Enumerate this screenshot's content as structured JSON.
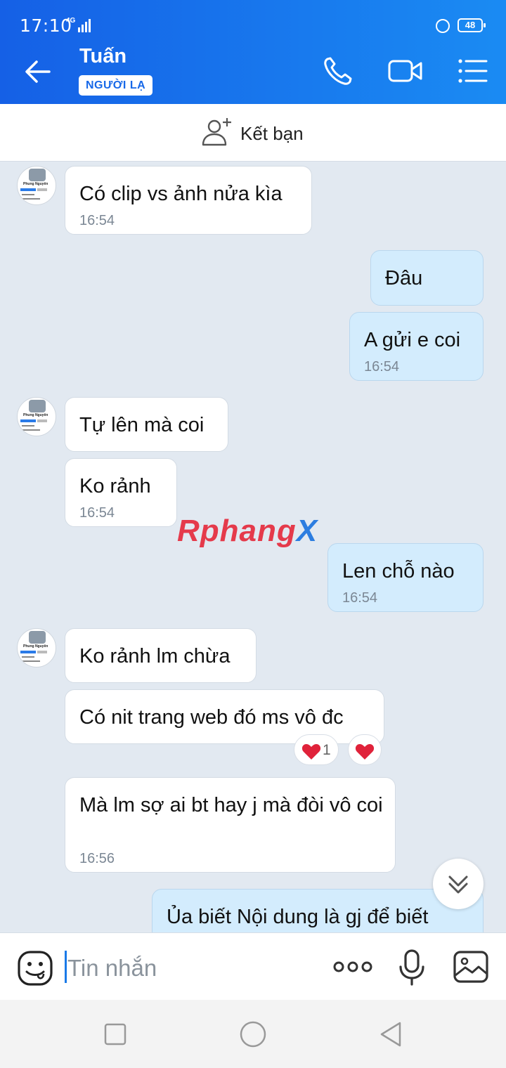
{
  "status": {
    "time": "17:10",
    "network": "4G",
    "battery": "48"
  },
  "header": {
    "name": "Tuấn",
    "badge": "NGƯỜI LẠ"
  },
  "add_friend": {
    "label": "Kết bạn"
  },
  "messages": [
    {
      "text": "Có clip vs ảnh nửa kìa",
      "time": "16:54"
    },
    {
      "text": "Đâu"
    },
    {
      "text": "A gửi e coi",
      "time": "16:54"
    },
    {
      "text": "Tự lên mà coi"
    },
    {
      "text": "Ko rảnh",
      "time": "16:54"
    },
    {
      "text": "Len chỗ nào",
      "time": "16:54"
    },
    {
      "text": "Ko rảnh lm chừa"
    },
    {
      "text": "Có nit trang web đó ms vô đc",
      "reaction_count": "1"
    },
    {
      "text": "Mà lm sợ ai bt hay j mà đòi vô coi",
      "time": "16:56"
    },
    {
      "text": "Ủa  biết  Nội dung là gj để biết"
    }
  ],
  "avatar": {
    "name": "Phung Nguyên"
  },
  "watermark": {
    "part1": "Rphang",
    "part2": "X"
  },
  "composer": {
    "placeholder": "Tin nhắn"
  },
  "colors": {
    "header_start": "#1560e6",
    "header_end": "#1a8bf3",
    "incoming": "#ffffff",
    "outgoing": "#d3ecfd",
    "heart": "#e0223a"
  }
}
